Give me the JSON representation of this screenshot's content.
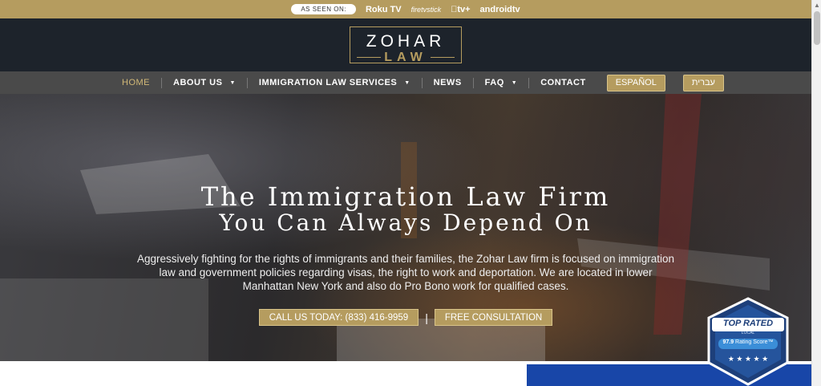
{
  "topbar": {
    "seen_on": "AS SEEN ON:",
    "brands": [
      "Roku TV",
      "firetvstick",
      "tv+",
      "androidtv"
    ]
  },
  "logo": {
    "top": "ZOHAR",
    "bottom": "LAW"
  },
  "nav": {
    "items": [
      {
        "label": "HOME",
        "active": true
      },
      {
        "label": "ABOUT US",
        "dropdown": true
      },
      {
        "label": "IMMIGRATION LAW SERVICES",
        "dropdown": true
      },
      {
        "label": "NEWS"
      },
      {
        "label": "FAQ",
        "dropdown": true
      },
      {
        "label": "CONTACT"
      }
    ],
    "lang_es": "ESPAÑOL",
    "lang_he": "עברית"
  },
  "hero": {
    "title_line1": "The Immigration Law Firm",
    "title_line2": "You Can Always Depend On",
    "description": "Aggressively fighting for the rights of immigrants and their families, the Zohar Law firm is focused on immigration law and government policies regarding visas, the right to work and deportation. We are located in lower Manhattan New York and also do Pro Bono work for qualified cases.",
    "cta_call": "CALL US TODAY: (833) 416-9959",
    "cta_separator": "|",
    "cta_consult": "FREE CONSULTATION"
  },
  "badge": {
    "label": "TOP RATED",
    "sub": "LOCAL",
    "score": "97.9",
    "score_label": "Rating Score™",
    "stars": "★ ★ ★ ★ ★"
  },
  "colors": {
    "gold": "#b59c5f",
    "dark": "#1d232b",
    "nav": "#4a4a4a",
    "blue": "#1846a8"
  },
  "icons": [
    "caret-down-icon",
    "apple-icon"
  ]
}
